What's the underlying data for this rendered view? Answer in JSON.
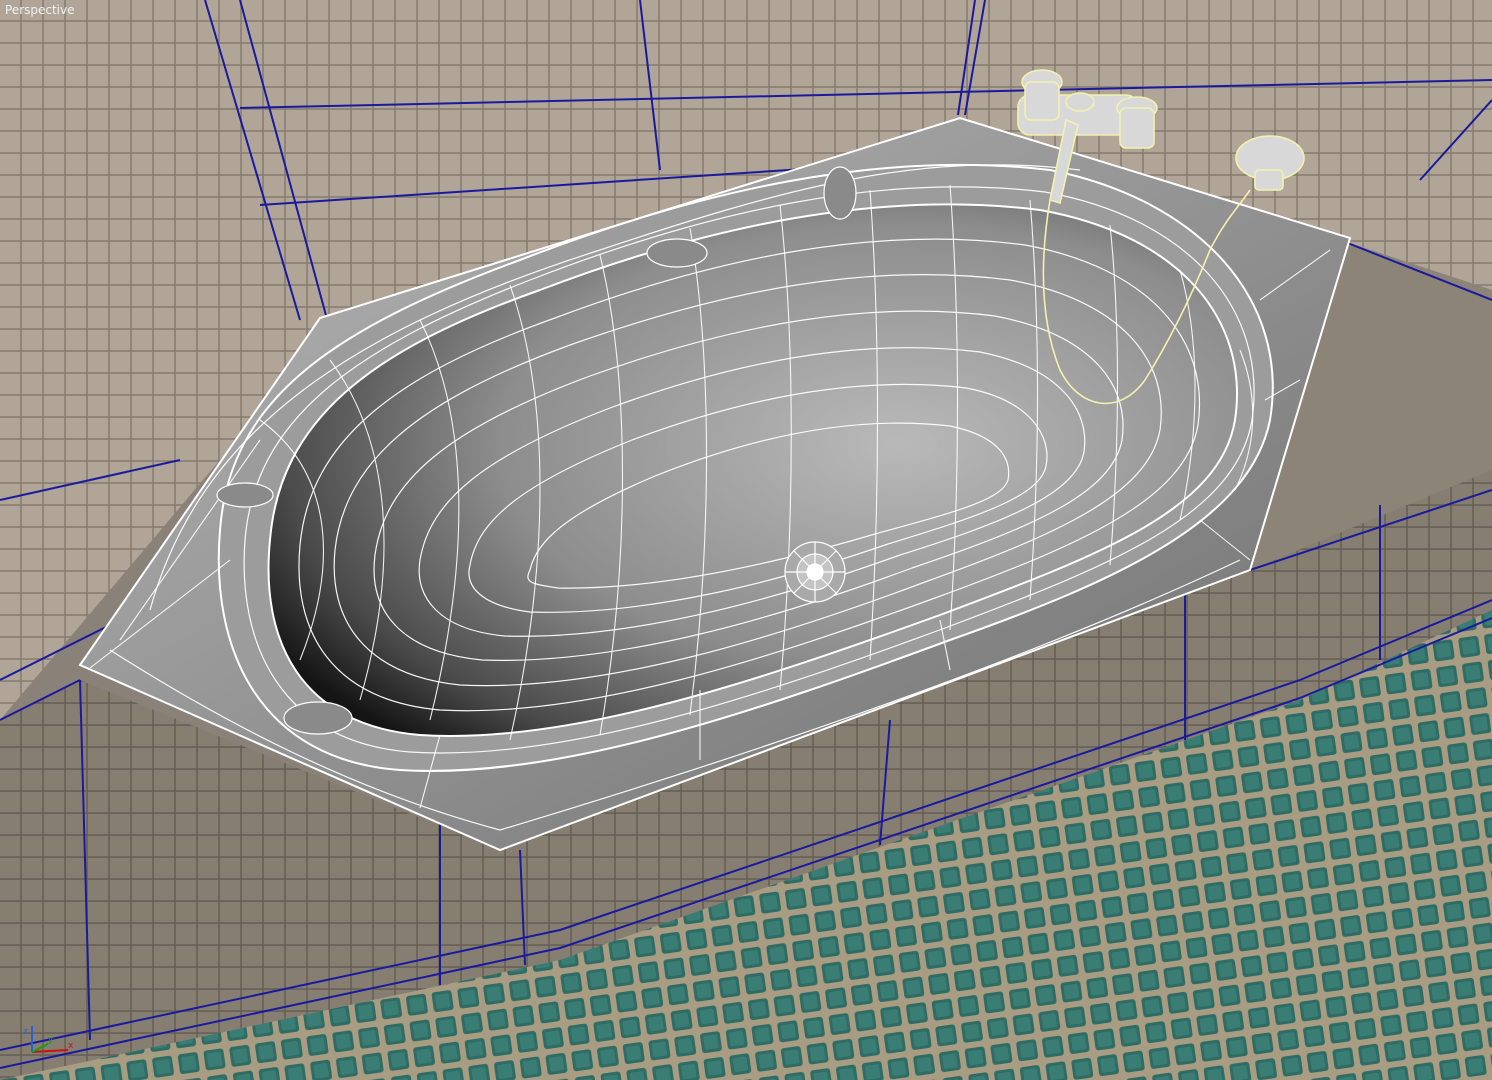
{
  "viewport": {
    "label": "Perspective",
    "shading": "Smooth + Highlights + Edged Faces"
  },
  "gizmo": {
    "axis_x": "x",
    "axis_y": "y",
    "axis_z": "z",
    "x_color": "#d01010",
    "y_color": "#10a010",
    "z_color": "#2a5fd6"
  },
  "colors": {
    "wall_tile": "#a69b8d",
    "floor_tile": "#2f6c64",
    "grid_line": "#1a1a9e",
    "wire": "#ffffff",
    "selected_wire": "#f2f2b0"
  }
}
